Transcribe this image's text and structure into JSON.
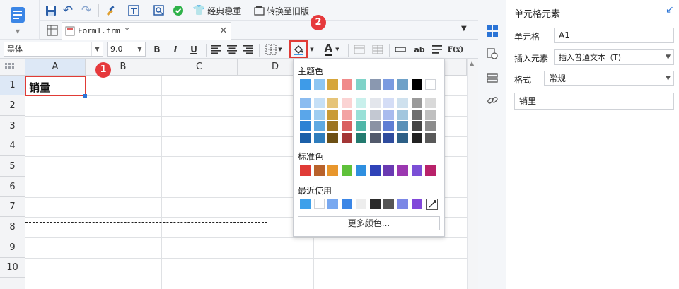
{
  "toolbar": {
    "classic_theme_label": "经典稳重",
    "convert_label": "转换至旧版"
  },
  "tab": {
    "label": "Form1.frm *"
  },
  "format": {
    "font_name": "黑体",
    "font_size": "9.0",
    "bold": "B",
    "italic": "I",
    "underline": "U",
    "fontcolor_glyph": "A",
    "ab_label": "ab",
    "fx_label": "F(x)"
  },
  "grid": {
    "columns": [
      "A",
      "B",
      "C",
      "D"
    ],
    "rows": [
      "1",
      "2",
      "3",
      "4",
      "5",
      "6",
      "7",
      "8",
      "9",
      "10"
    ],
    "cell_a1": "销量"
  },
  "badges": {
    "one": "1",
    "two": "2"
  },
  "color_popup": {
    "theme_label": "主题色",
    "standard_label": "标准色",
    "recent_label": "最近使用",
    "more_label": "更多颜色...",
    "theme_top": [
      "#3e9be8",
      "#8ec6f2",
      "#d6a53a",
      "#f08a8a",
      "#7fd3c8",
      "#8a98b0",
      "#7b9be0",
      "#6fa1c8",
      "#000000",
      "#ffffff"
    ],
    "theme_columns": [
      [
        "#8bbcf0",
        "#5aa6ea",
        "#2d82d4",
        "#1b5fa8"
      ],
      [
        "#c6e0f7",
        "#9fcdf1",
        "#5fa9e2",
        "#2e7dbd"
      ],
      [
        "#e6c479",
        "#c99a35",
        "#9c7422",
        "#6c4f14"
      ],
      [
        "#fbd3d3",
        "#f3a3a3",
        "#d96060",
        "#a33636"
      ],
      [
        "#c9f0ec",
        "#98e0d7",
        "#4fb6a8",
        "#237a6f"
      ],
      [
        "#e3e6ec",
        "#c3c8d2",
        "#8a92a4",
        "#525a6c"
      ],
      [
        "#d4ddf6",
        "#a9bbee",
        "#5f7ed4",
        "#2f4c9e"
      ],
      [
        "#cfe1ee",
        "#a2c6de",
        "#5a90b8",
        "#2d5f86"
      ],
      [
        "#9a9a9a",
        "#6e6e6e",
        "#454545",
        "#222222"
      ],
      [
        "#d9d9d9",
        "#bfbfbf",
        "#8c8c8c",
        "#595959"
      ]
    ],
    "standard": [
      "#e03b36",
      "#b9622b",
      "#e8962c",
      "#5fc13a",
      "#2f8fe0",
      "#2f43b8",
      "#6a3ab2",
      "#9b37b0",
      "#7b4fd6",
      "#b8226a"
    ],
    "recent": [
      "#3ea0ea",
      "#ffffff",
      "#78a8f0",
      "#3b86e6",
      "#ededed",
      "#2b2b2b",
      "#555555",
      "#7b87e6",
      "#8148da"
    ]
  },
  "panel": {
    "title": "单元格元素",
    "cell_label": "单元格",
    "cell_value": "A1",
    "insert_label": "插入元素",
    "insert_value": "插入普通文本（T)",
    "format_label": "格式",
    "format_value": "常规",
    "content_value": "销里"
  },
  "colors": {
    "accent": "#2b5fa8",
    "badge": "#e6393c",
    "highlight": "#e03b36"
  }
}
